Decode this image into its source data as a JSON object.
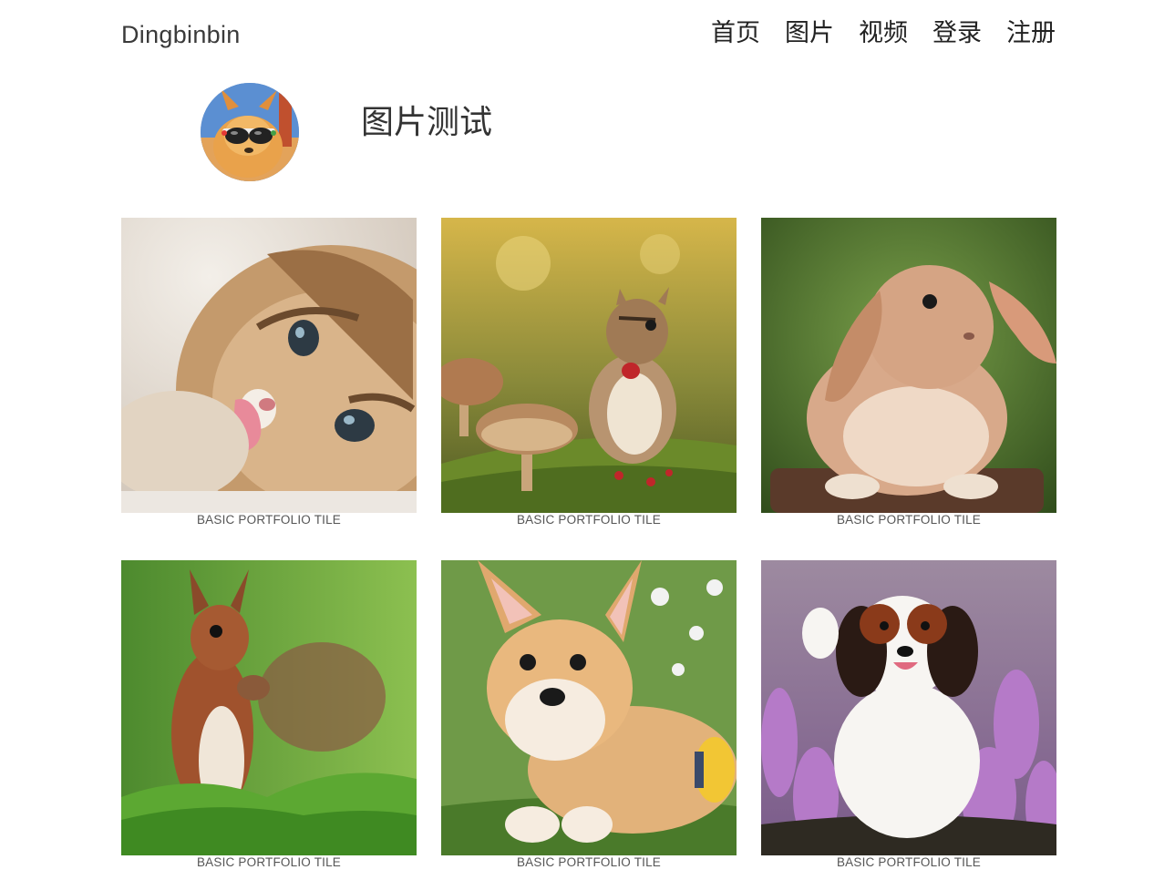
{
  "header": {
    "brand": "Dingbinbin",
    "nav": [
      "首页",
      "图片",
      "视频",
      "登录",
      "注册"
    ]
  },
  "profile": {
    "avatar_icon": "dog-with-sunglasses-avatar",
    "title": "图片测试"
  },
  "gallery": {
    "tiles": [
      {
        "image": "kitten",
        "caption": "BASIC PORTFOLIO TILE"
      },
      {
        "image": "chipmunk-with-mushrooms",
        "caption": "BASIC PORTFOLIO TILE"
      },
      {
        "image": "lop-eared-rabbit",
        "caption": "BASIC PORTFOLIO TILE"
      },
      {
        "image": "red-squirrel-in-grass",
        "caption": "BASIC PORTFOLIO TILE"
      },
      {
        "image": "corgi-puppy",
        "caption": "BASIC PORTFOLIO TILE"
      },
      {
        "image": "spaniel-in-heather",
        "caption": "BASIC PORTFOLIO TILE"
      }
    ]
  },
  "colors": {
    "text": "#333333",
    "caption": "#555555",
    "background": "#ffffff"
  }
}
